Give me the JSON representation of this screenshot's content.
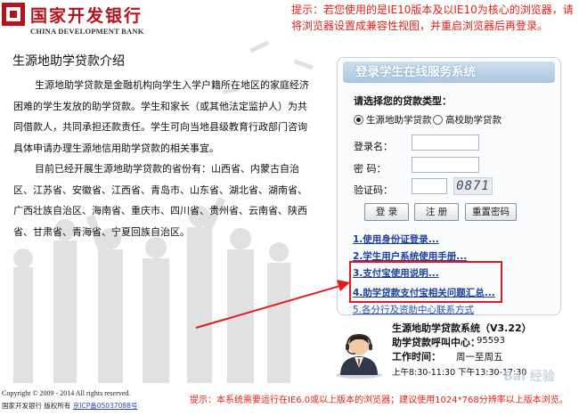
{
  "header": {
    "bank_name_cn": "国家开发银行",
    "bank_name_en": "CHINA DEVELOPMENT BANK",
    "tip": "提示：若您使用的是IE10版本及以IE10为核心的浏览器，请将浏览器设置成兼容性视图，并重启浏览器后再登录。"
  },
  "intro": {
    "title": "生源地助学贷款介绍",
    "paragraphs": [
      "生源地助学贷款是金融机构向学生入学户籍所在地区的家庭经济困难的学生发放的助学贷款。学生和家长（或其他法定监护人）为共同借款人，共同承担还款责任。学生可向当地县级教育行政部门咨询具体申请办理生源地信用助学贷款的相关事宜。",
      "目前已经开展生源地助学贷款的省份有：山西省、内蒙古自治区、江苏省、安徽省、江西省、青岛市、山东省、湖北省、湖南省、广西壮族自治区、海南省、重庆市、四川省、贵州省、云南省、陕西省、甘肃省、青海省、宁夏回族自治区。"
    ]
  },
  "login": {
    "panel_title": "登录学生在线服务系统",
    "loan_type_label": "请选择您的贷款类型：",
    "loan_types": [
      {
        "label": "生源地助学贷款",
        "checked": true
      },
      {
        "label": "高校助学贷款",
        "checked": false
      }
    ],
    "username_label": "登录名：",
    "password_label": "密  码：",
    "captcha_label": "验证码：",
    "captcha_text": "0871",
    "buttons": {
      "login": "登  录",
      "register": "注  册",
      "reset_password": "重置密码"
    },
    "links": [
      "1.使用身份证登录...",
      "2.学生用户系统使用手册...",
      "3.支付宝使用说明...",
      "4.助学贷款支付宝相关问题汇总...",
      "5.各分行及资助中心联系方式"
    ]
  },
  "contact": {
    "system_name": "生源地助学贷款系统（V3.22）",
    "hotline_label": "助学贷款呼叫中心：",
    "hotline_number": "95593",
    "hours_label": "工作时间：",
    "hours_days": "周一至周五",
    "hours_time": "上午8:30-11:30  下午13:30-17:30"
  },
  "footer": {
    "copyright": "Copyright © 2009 - 2014 All rights reserved.",
    "org": "国家开发银行  版权所有",
    "icp": "京ICP备05037088号",
    "tip": "提示：本系统需要运行在IE6.0或以上版本的浏览器；建议使用1024*768分辨率以上版本浏览。"
  },
  "watermark": "Bai 经验",
  "colors": {
    "brand_red": "#b5121b",
    "tip_red": "#e0231a",
    "link_blue": "#1d3fa0",
    "panel_header": "#a9c6de"
  }
}
